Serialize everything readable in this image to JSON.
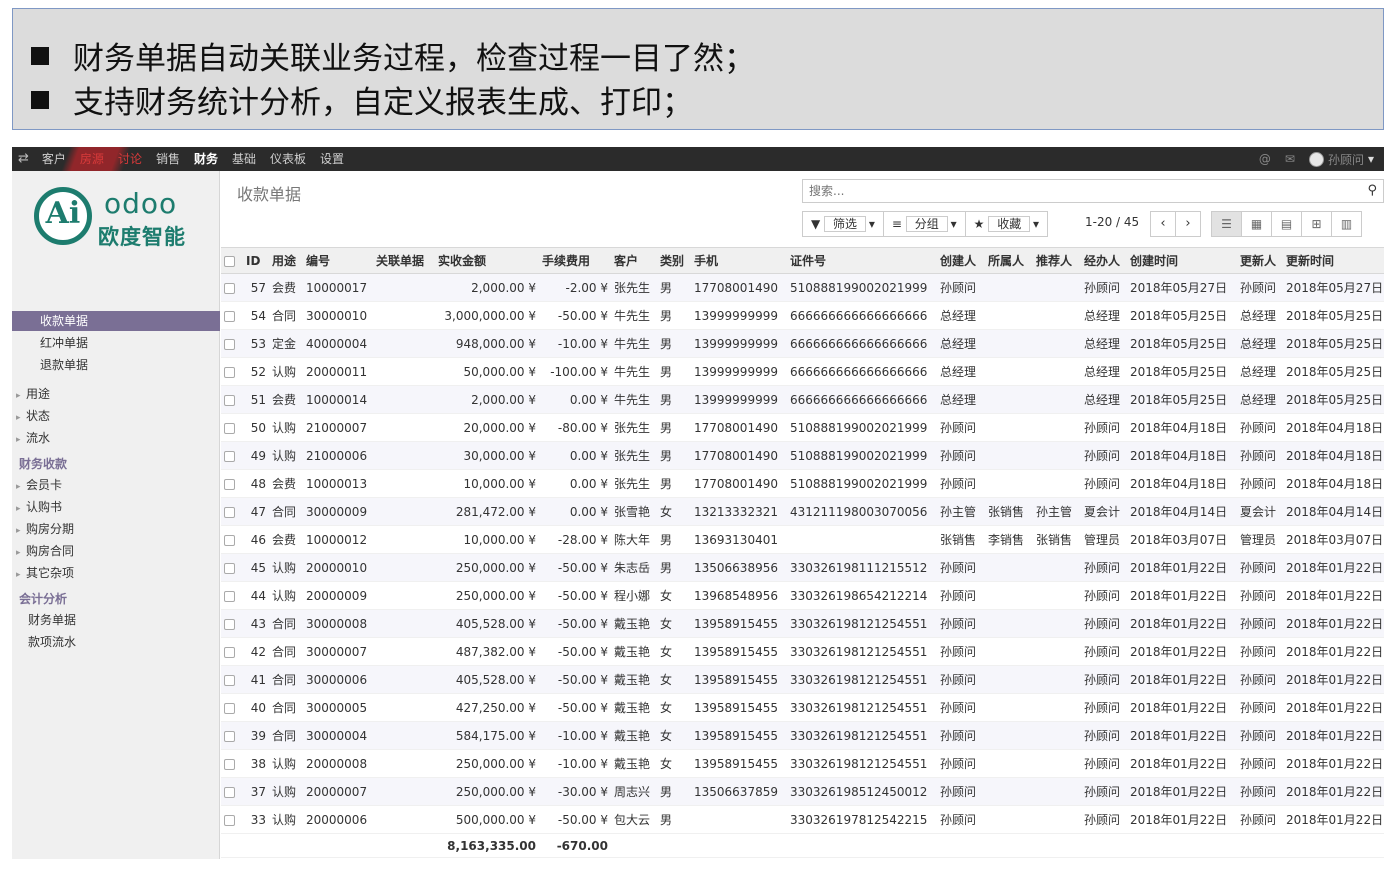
{
  "banner": {
    "line1": "财务单据自动关联业务过程，检查过程一目了然；",
    "line2": "支持财务统计分析，自定义报表生成、打印；"
  },
  "topbar": {
    "menus": [
      "客户",
      "房源",
      "讨论",
      "销售",
      "财务",
      "基础",
      "仪表板",
      "设置"
    ],
    "active_menu": "财务",
    "user": "孙顾问"
  },
  "logo": {
    "brand": "odoo",
    "cn": "欧度智能",
    "mark": "Ai"
  },
  "sidebar": {
    "items1": [
      "收款单据",
      "红冲单据",
      "退款单据"
    ],
    "items2": [
      "用途",
      "状态",
      "流水"
    ],
    "group1": "财务收款",
    "items3": [
      "会员卡",
      "认购书",
      "购房分期",
      "购房合同",
      "其它杂项"
    ],
    "group2": "会计分析",
    "items4": [
      "财务单据",
      "款项流水"
    ]
  },
  "main": {
    "title": "收款单据",
    "search_placeholder": "搜索...",
    "filter_label": "筛选",
    "group_label": "分组",
    "fav_label": "收藏",
    "pager": "1-20 / 45"
  },
  "table": {
    "headers": [
      "ID",
      "用途",
      "编号",
      "关联单据",
      "实收金额",
      "手续费用",
      "客户",
      "类别",
      "手机",
      "证件号",
      "创建人",
      "所属人",
      "推荐人",
      "经办人",
      "创建时间",
      "更新人",
      "更新时间"
    ],
    "rows": [
      [
        "57",
        "会费",
        "10000017",
        "",
        "2,000.00 ¥",
        "-2.00 ¥",
        "张先生",
        "男",
        "17708001490",
        "510888199002021999",
        "孙顾问",
        "",
        "",
        "孙顾问",
        "2018年05月27日",
        "孙顾问",
        "2018年05月27日"
      ],
      [
        "54",
        "合同",
        "30000010",
        "",
        "3,000,000.00 ¥",
        "-50.00 ¥",
        "牛先生",
        "男",
        "13999999999",
        "666666666666666666",
        "总经理",
        "",
        "",
        "总经理",
        "2018年05月25日",
        "总经理",
        "2018年05月25日"
      ],
      [
        "53",
        "定金",
        "40000004",
        "",
        "948,000.00 ¥",
        "-10.00 ¥",
        "牛先生",
        "男",
        "13999999999",
        "666666666666666666",
        "总经理",
        "",
        "",
        "总经理",
        "2018年05月25日",
        "总经理",
        "2018年05月25日"
      ],
      [
        "52",
        "认购",
        "20000011",
        "",
        "50,000.00 ¥",
        "-100.00 ¥",
        "牛先生",
        "男",
        "13999999999",
        "666666666666666666",
        "总经理",
        "",
        "",
        "总经理",
        "2018年05月25日",
        "总经理",
        "2018年05月25日"
      ],
      [
        "51",
        "会费",
        "10000014",
        "",
        "2,000.00 ¥",
        "0.00 ¥",
        "牛先生",
        "男",
        "13999999999",
        "666666666666666666",
        "总经理",
        "",
        "",
        "总经理",
        "2018年05月25日",
        "总经理",
        "2018年05月25日"
      ],
      [
        "50",
        "认购",
        "21000007",
        "",
        "20,000.00 ¥",
        "-80.00 ¥",
        "张先生",
        "男",
        "17708001490",
        "510888199002021999",
        "孙顾问",
        "",
        "",
        "孙顾问",
        "2018年04月18日",
        "孙顾问",
        "2018年04月18日"
      ],
      [
        "49",
        "认购",
        "21000006",
        "",
        "30,000.00 ¥",
        "0.00 ¥",
        "张先生",
        "男",
        "17708001490",
        "510888199002021999",
        "孙顾问",
        "",
        "",
        "孙顾问",
        "2018年04月18日",
        "孙顾问",
        "2018年04月18日"
      ],
      [
        "48",
        "会费",
        "10000013",
        "",
        "10,000.00 ¥",
        "0.00 ¥",
        "张先生",
        "男",
        "17708001490",
        "510888199002021999",
        "孙顾问",
        "",
        "",
        "孙顾问",
        "2018年04月18日",
        "孙顾问",
        "2018年04月18日"
      ],
      [
        "47",
        "合同",
        "30000009",
        "",
        "281,472.00 ¥",
        "0.00 ¥",
        "张雪艳",
        "女",
        "13213332321",
        "431211198003070056",
        "孙主管",
        "张销售",
        "孙主管",
        "夏会计",
        "2018年04月14日",
        "夏会计",
        "2018年04月14日"
      ],
      [
        "46",
        "会费",
        "10000012",
        "",
        "10,000.00 ¥",
        "-28.00 ¥",
        "陈大年",
        "男",
        "13693130401",
        "",
        "张销售",
        "李销售",
        "张销售",
        "管理员",
        "2018年03月07日",
        "管理员",
        "2018年03月07日"
      ],
      [
        "45",
        "认购",
        "20000010",
        "",
        "250,000.00 ¥",
        "-50.00 ¥",
        "朱志岳",
        "男",
        "13506638956",
        "330326198111215512",
        "孙顾问",
        "",
        "",
        "孙顾问",
        "2018年01月22日",
        "孙顾问",
        "2018年01月22日"
      ],
      [
        "44",
        "认购",
        "20000009",
        "",
        "250,000.00 ¥",
        "-50.00 ¥",
        "程小娜",
        "女",
        "13968548956",
        "330326198654212214",
        "孙顾问",
        "",
        "",
        "孙顾问",
        "2018年01月22日",
        "孙顾问",
        "2018年01月22日"
      ],
      [
        "43",
        "合同",
        "30000008",
        "",
        "405,528.00 ¥",
        "-50.00 ¥",
        "戴玉艳",
        "女",
        "13958915455",
        "330326198121254551",
        "孙顾问",
        "",
        "",
        "孙顾问",
        "2018年01月22日",
        "孙顾问",
        "2018年01月22日"
      ],
      [
        "42",
        "合同",
        "30000007",
        "",
        "487,382.00 ¥",
        "-50.00 ¥",
        "戴玉艳",
        "女",
        "13958915455",
        "330326198121254551",
        "孙顾问",
        "",
        "",
        "孙顾问",
        "2018年01月22日",
        "孙顾问",
        "2018年01月22日"
      ],
      [
        "41",
        "合同",
        "30000006",
        "",
        "405,528.00 ¥",
        "-50.00 ¥",
        "戴玉艳",
        "女",
        "13958915455",
        "330326198121254551",
        "孙顾问",
        "",
        "",
        "孙顾问",
        "2018年01月22日",
        "孙顾问",
        "2018年01月22日"
      ],
      [
        "40",
        "合同",
        "30000005",
        "",
        "427,250.00 ¥",
        "-50.00 ¥",
        "戴玉艳",
        "女",
        "13958915455",
        "330326198121254551",
        "孙顾问",
        "",
        "",
        "孙顾问",
        "2018年01月22日",
        "孙顾问",
        "2018年01月22日"
      ],
      [
        "39",
        "合同",
        "30000004",
        "",
        "584,175.00 ¥",
        "-10.00 ¥",
        "戴玉艳",
        "女",
        "13958915455",
        "330326198121254551",
        "孙顾问",
        "",
        "",
        "孙顾问",
        "2018年01月22日",
        "孙顾问",
        "2018年01月22日"
      ],
      [
        "38",
        "认购",
        "20000008",
        "",
        "250,000.00 ¥",
        "-10.00 ¥",
        "戴玉艳",
        "女",
        "13958915455",
        "330326198121254551",
        "孙顾问",
        "",
        "",
        "孙顾问",
        "2018年01月22日",
        "孙顾问",
        "2018年01月22日"
      ],
      [
        "37",
        "认购",
        "20000007",
        "",
        "250,000.00 ¥",
        "-30.00 ¥",
        "周志兴",
        "男",
        "13506637859",
        "330326198512450012",
        "孙顾问",
        "",
        "",
        "孙顾问",
        "2018年01月22日",
        "孙顾问",
        "2018年01月22日"
      ],
      [
        "33",
        "认购",
        "20000006",
        "",
        "500,000.00 ¥",
        "-50.00 ¥",
        "包大云",
        "男",
        "",
        "330326197812542215",
        "孙顾问",
        "",
        "",
        "孙顾问",
        "2018年01月22日",
        "孙顾问",
        "2018年01月22日"
      ]
    ],
    "total_amount": "8,163,335.00",
    "total_fee": "-670.00"
  }
}
